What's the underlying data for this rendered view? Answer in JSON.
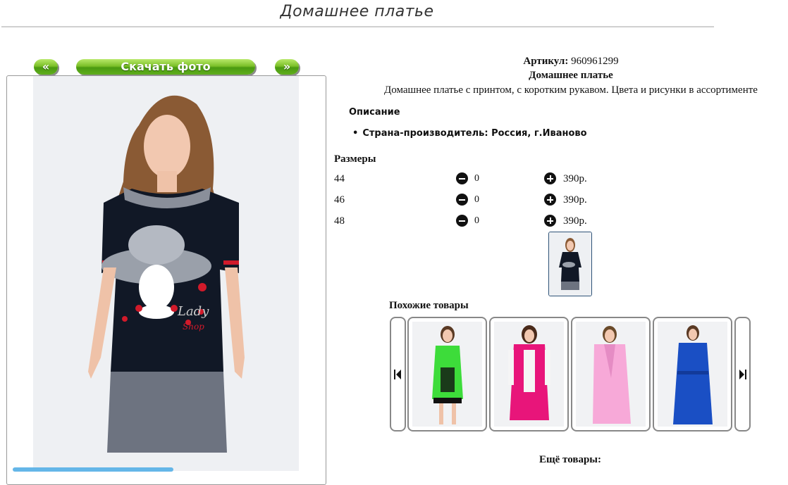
{
  "header": {
    "title": "Домашнее платье"
  },
  "nav": {
    "prev_label": "«",
    "download_label": "Скачать фото",
    "next_label": "»"
  },
  "product": {
    "sku_label": "Артикул:",
    "sku_value": "960961299",
    "name": "Домашнее платье",
    "description": "Домашнее платье с принтом, с коротким рукавом. Цвета и рисунки в ассортименте",
    "details_title": "Описание",
    "details": [
      "Страна-производитель: Россия, г.Иваново"
    ]
  },
  "sizes": {
    "title": "Размеры",
    "rows": [
      {
        "size": "44",
        "qty": "0",
        "price": "390р."
      },
      {
        "size": "46",
        "qty": "0",
        "price": "390р."
      },
      {
        "size": "48",
        "qty": "0",
        "price": "390р."
      }
    ]
  },
  "similar": {
    "title": "Похожие товары"
  },
  "more": {
    "title": "Ещё товары:"
  },
  "colors": {
    "button_green": "#6bb81f",
    "frame": "#999999",
    "thumb_border": "#2e5277",
    "blue_bar": "#64b6e8"
  },
  "icons": {
    "minus": "minus-circle-icon",
    "plus": "plus-circle-icon",
    "carousel_prev": "skip-back-icon",
    "carousel_next": "skip-forward-icon"
  }
}
